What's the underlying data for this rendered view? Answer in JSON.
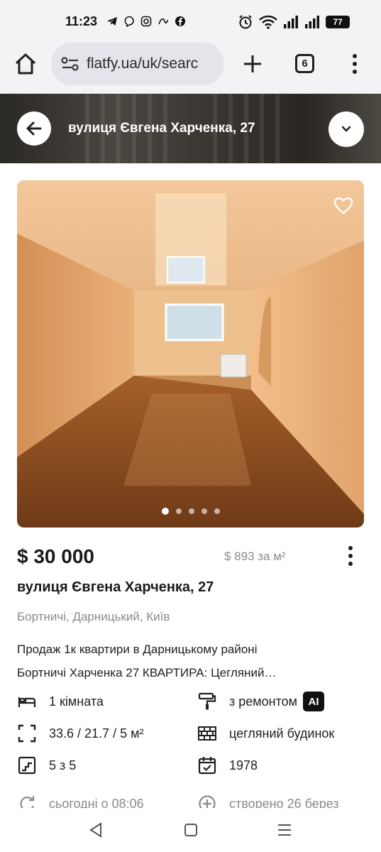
{
  "status_bar": {
    "time": "11:23",
    "app_icons": [
      "telegram-icon",
      "viber-icon",
      "instagram-icon",
      "app-icon",
      "facebook-icon"
    ],
    "battery": "77"
  },
  "browser": {
    "url": "flatfy.ua/uk/searc",
    "tab_count": "6"
  },
  "header": {
    "title": "вулиця Євгена Харченка, 27"
  },
  "gallery": {
    "total_photos": 5,
    "active_index": 0
  },
  "listing": {
    "price": "$ 30 000",
    "price_per_sqm": "$ 893 за м²",
    "address": "вулиця Євгена Харченка, 27",
    "district": "Бортничі, Дарницький, Київ",
    "description_line1": "Продаж 1к квартири в Дарницькому районі",
    "description_line2": "Бортничі Харченка 27 КВАРТИРА: Цегляний…"
  },
  "features": {
    "rooms": "1 кімната",
    "renovation": "з ремонтом",
    "ai_badge": "AI",
    "area": "33.6 / 21.7 / 5 м²",
    "building": "цегляний будинок",
    "floor": "5 з 5",
    "year": "1978",
    "updated": "сьогодні о 08:06",
    "created": "створено 26 берез"
  },
  "colors": {
    "accent": "#1a1a1a",
    "muted": "#8a8a8a",
    "toolbar_bg": "#f3f3f6"
  }
}
